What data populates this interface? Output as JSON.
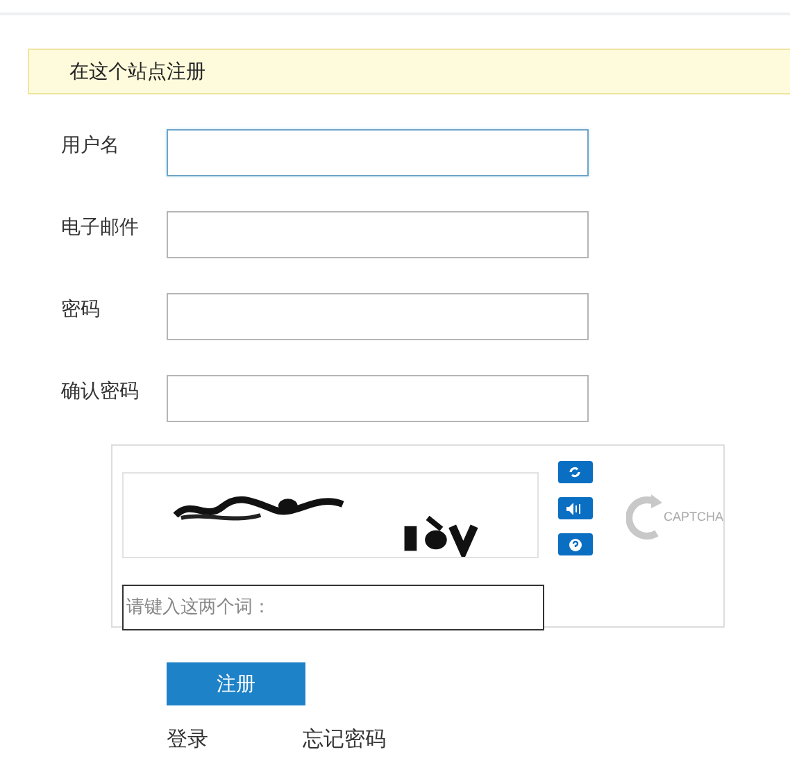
{
  "notice": {
    "text": "在这个站点注册"
  },
  "fields": [
    {
      "label": "用户名",
      "focused": true
    },
    {
      "label": "电子邮件",
      "focused": false
    },
    {
      "label": "密码",
      "focused": false
    },
    {
      "label": "确认密码",
      "focused": false
    }
  ],
  "captcha": {
    "kind": "picture",
    "logo": "CAPTCHA",
    "answer": {
      "placeholder": "请键入这两个词："
    }
  },
  "submit": "注册",
  "links": [
    "登录",
    "忘记密码"
  ]
}
